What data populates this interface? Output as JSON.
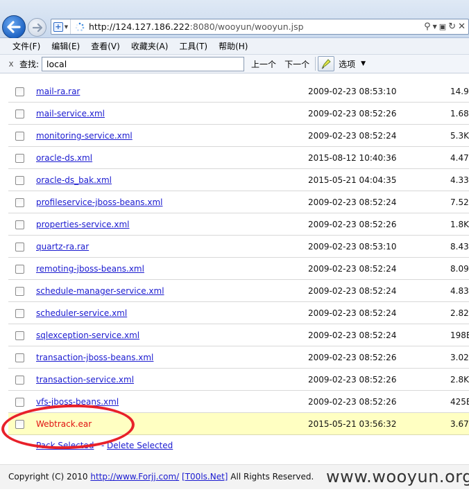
{
  "browser": {
    "url_host": "http://124.127.186.222",
    "url_rest": ":8080/wooyun/wooyun.jsp",
    "menu": [
      "文件(F)",
      "编辑(E)",
      "查看(V)",
      "收藏夹(A)",
      "工具(T)",
      "帮助(H)"
    ],
    "find": {
      "close": "x",
      "label": "查找:",
      "value": "local",
      "prev": "上一个",
      "next": "下一个",
      "options": "选项"
    }
  },
  "files": [
    {
      "name": "mail-ra.rar",
      "date": "2009-02-23 08:53:10",
      "size": "14.9"
    },
    {
      "name": "mail-service.xml",
      "date": "2009-02-23 08:52:26",
      "size": "1.68"
    },
    {
      "name": "monitoring-service.xml",
      "date": "2009-02-23 08:52:24",
      "size": "5.3K"
    },
    {
      "name": "oracle-ds.xml",
      "date": "2015-08-12 10:40:36",
      "size": "4.47"
    },
    {
      "name": "oracle-ds_bak.xml",
      "date": "2015-05-21 04:04:35",
      "size": "4.33"
    },
    {
      "name": "profileservice-jboss-beans.xml",
      "date": "2009-02-23 08:52:24",
      "size": "7.52"
    },
    {
      "name": "properties-service.xml",
      "date": "2009-02-23 08:52:26",
      "size": "1.8K"
    },
    {
      "name": "quartz-ra.rar",
      "date": "2009-02-23 08:53:10",
      "size": "8.43"
    },
    {
      "name": "remoting-jboss-beans.xml",
      "date": "2009-02-23 08:52:24",
      "size": "8.09"
    },
    {
      "name": "schedule-manager-service.xml",
      "date": "2009-02-23 08:52:24",
      "size": "4.83"
    },
    {
      "name": "scheduler-service.xml",
      "date": "2009-02-23 08:52:24",
      "size": "2.82"
    },
    {
      "name": "sqlexception-service.xml",
      "date": "2009-02-23 08:52:24",
      "size": "198E"
    },
    {
      "name": "transaction-jboss-beans.xml",
      "date": "2009-02-23 08:52:26",
      "size": "3.02"
    },
    {
      "name": "transaction-service.xml",
      "date": "2009-02-23 08:52:26",
      "size": "2.8K"
    },
    {
      "name": "vfs-jboss-beans.xml",
      "date": "2009-02-23 08:52:26",
      "size": "425E"
    },
    {
      "name": "Webtrack.ear",
      "date": "2015-05-21 03:56:32",
      "size": "3.67"
    }
  ],
  "actions": {
    "pack": "Pack Selected",
    "separator": "-",
    "delete": "Delete Selected"
  },
  "footer": {
    "copyright": "Copyright (C) 2010",
    "link1": "http://www.Forjj.com/",
    "link2": "[T00ls.Net]",
    "rights": "All Rights Reserved.",
    "watermark": "www.wooyun.org"
  },
  "colors": {
    "link": "#1a1ad0",
    "highlight_row": "#ffffc2",
    "highlight_text": "#e01010",
    "annotation": "#e8212a"
  }
}
